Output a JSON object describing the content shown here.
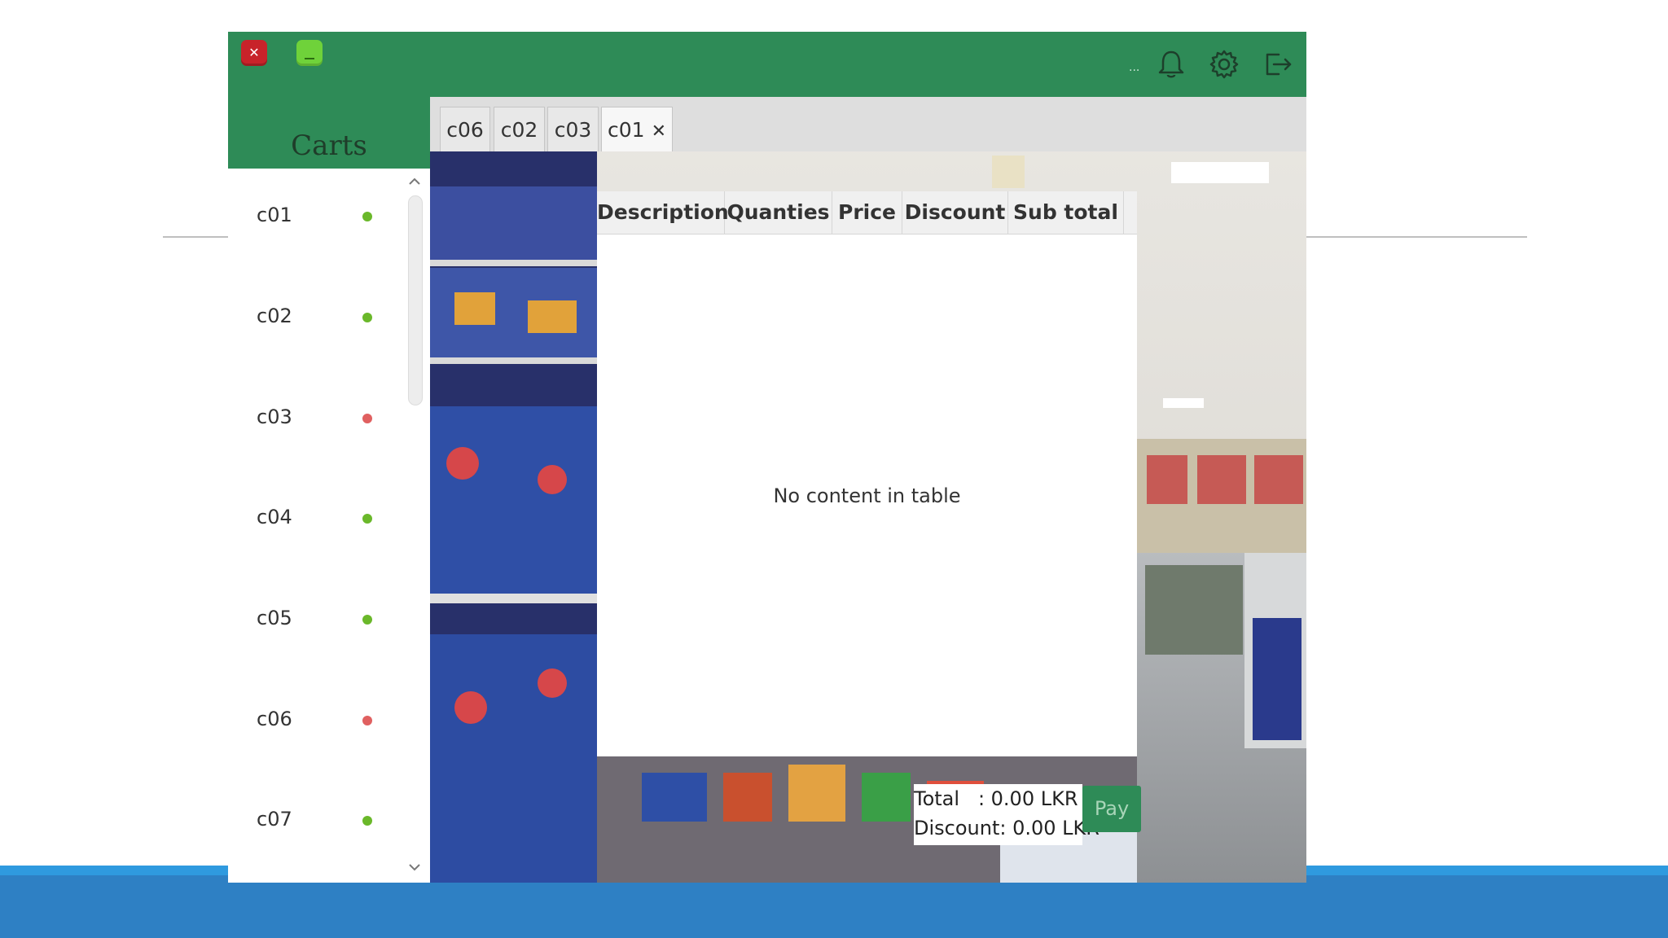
{
  "window": {
    "close_glyph": "✕",
    "ellipsis": "..."
  },
  "header_icons": [
    "bell-icon",
    "gear-icon",
    "logout-icon"
  ],
  "sidebar": {
    "title": "Carts",
    "items": [
      {
        "label": "c01",
        "status": "green"
      },
      {
        "label": "c02",
        "status": "green"
      },
      {
        "label": "c03",
        "status": "red"
      },
      {
        "label": "c04",
        "status": "green"
      },
      {
        "label": "c05",
        "status": "green"
      },
      {
        "label": "c06",
        "status": "red"
      },
      {
        "label": "c07",
        "status": "green"
      }
    ]
  },
  "tabs": [
    {
      "label": "c06",
      "active": false
    },
    {
      "label": "c02",
      "active": false
    },
    {
      "label": "c03",
      "active": false
    },
    {
      "label": "c01",
      "active": true,
      "close": "✕"
    }
  ],
  "table": {
    "columns": [
      "Description",
      "Quanties",
      "Price",
      "Discount",
      "Sub total"
    ],
    "rows": [],
    "empty_message": "No content in table"
  },
  "summary": {
    "total": "Total   : 0.00 LKR",
    "discount": "Discount: 0.00 LKR",
    "pay_label": "Pay"
  },
  "colors": {
    "header_green": "#2e8b57",
    "status_green": "#6ab82a",
    "status_red": "#e06060",
    "slide_blue": "#2e80c4"
  }
}
